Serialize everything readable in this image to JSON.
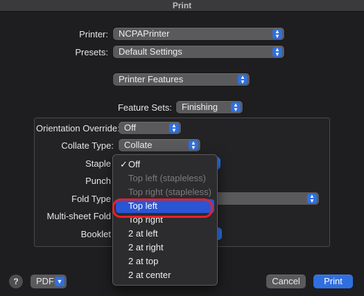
{
  "window": {
    "title": "Print"
  },
  "printer": {
    "label": "Printer:",
    "value": "NCPAPrinter"
  },
  "presets": {
    "label": "Presets:",
    "value": "Default Settings"
  },
  "section": {
    "value": "Printer Features"
  },
  "feature_sets": {
    "label": "Feature Sets:",
    "value": "Finishing"
  },
  "group": {
    "orientation_override": {
      "label": "Orientation Override:",
      "value": "Off"
    },
    "collate_type": {
      "label": "Collate Type:",
      "value": "Collate"
    },
    "staple": {
      "label": "Staple"
    },
    "punch": {
      "label": "Punch"
    },
    "fold_type": {
      "label": "Fold Type"
    },
    "multi_sheet_fold": {
      "label": "Multi-sheet Fold"
    },
    "booklet": {
      "label": "Booklet"
    }
  },
  "staple_menu": {
    "items": [
      {
        "label": "Off",
        "checked": true,
        "enabled": true,
        "selected": false
      },
      {
        "label": "Top left (stapleless)",
        "checked": false,
        "enabled": false,
        "selected": false
      },
      {
        "label": "Top right (stapleless)",
        "checked": false,
        "enabled": false,
        "selected": false
      },
      {
        "label": "Top left",
        "checked": false,
        "enabled": true,
        "selected": true
      },
      {
        "label": "Top right",
        "checked": false,
        "enabled": true,
        "selected": false
      },
      {
        "label": "2 at left",
        "checked": false,
        "enabled": true,
        "selected": false
      },
      {
        "label": "2 at right",
        "checked": false,
        "enabled": true,
        "selected": false
      },
      {
        "label": "2 at top",
        "checked": false,
        "enabled": true,
        "selected": false
      },
      {
        "label": "2 at center",
        "checked": false,
        "enabled": true,
        "selected": false
      }
    ],
    "check_glyph": "✓"
  },
  "footer": {
    "help_label": "?",
    "pdf_label": "PDF",
    "cancel_label": "Cancel",
    "print_label": "Print"
  },
  "colors": {
    "accent": "#2f6fe0",
    "selection": "#2a55d4",
    "annotation": "#e8222b"
  }
}
